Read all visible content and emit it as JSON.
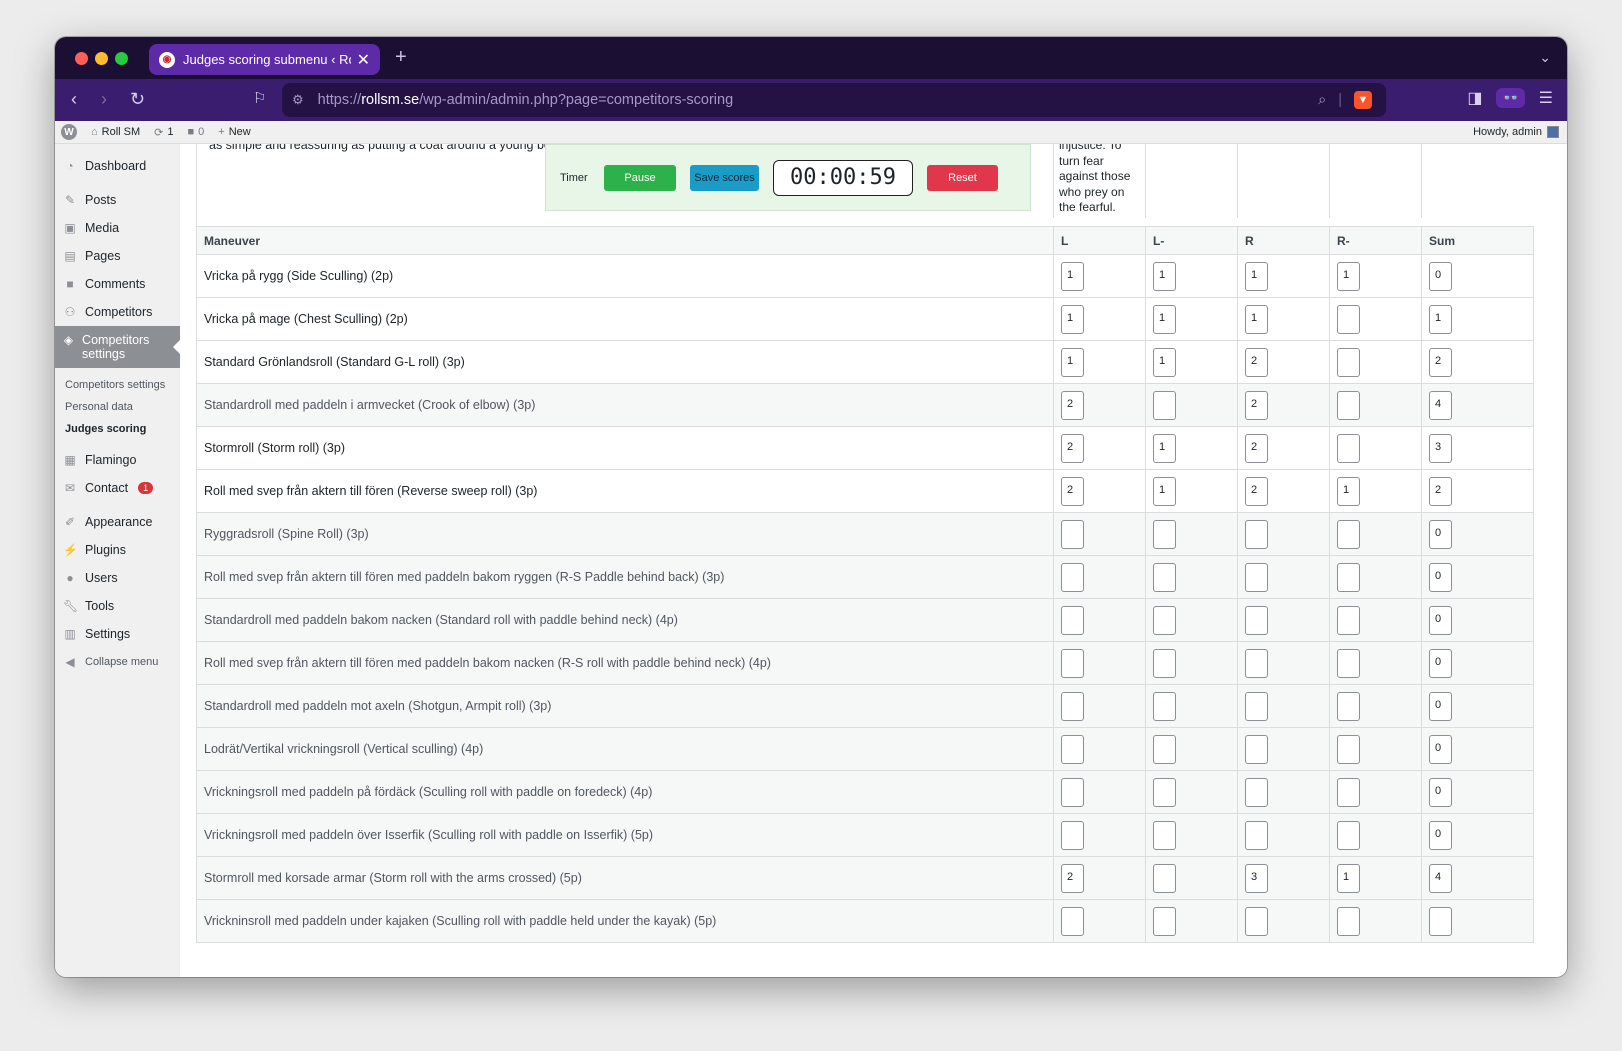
{
  "browser": {
    "tab_title": "Judges scoring submenu ‹ Ro",
    "url_prefix": "https://",
    "url_host": "rollsm.se",
    "url_path": "/wp-admin/admin.php?page=competitors-scoring"
  },
  "adminbar": {
    "site_name": "Roll SM",
    "updates_count": "1",
    "comments_count": "0",
    "new_label": "New",
    "howdy": "Howdy, admin"
  },
  "sidebar": {
    "dashboard": "Dashboard",
    "posts": "Posts",
    "media": "Media",
    "pages": "Pages",
    "comments": "Comments",
    "competitors": "Competitors",
    "competitors_settings": "Competitors settings",
    "sub_competitors_settings": "Competitors settings",
    "sub_personal_data": "Personal data",
    "sub_judges_scoring": "Judges scoring",
    "flamingo": "Flamingo",
    "contact": "Contact",
    "contact_badge": "1",
    "appearance": "Appearance",
    "plugins": "Plugins",
    "users": "Users",
    "tools": "Tools",
    "settings": "Settings",
    "collapse": "Collapse menu"
  },
  "top": {
    "story_text": "as simple and reassuring as putting a coat around a young boy",
    "quote_lines": [
      "injustice. To",
      "turn fear",
      "against those",
      "who prey on",
      "the fearful."
    ]
  },
  "timer": {
    "label": "Timer",
    "pause_label": "Pause",
    "save_label": "Save scores",
    "display": "00:00:59",
    "reset_label": "Reset"
  },
  "table": {
    "headers": [
      "Maneuver",
      "L",
      "L-",
      "R",
      "R-",
      "Sum"
    ],
    "rows": [
      {
        "name": "Vricka på rygg (Side Sculling) (2p)",
        "L": "1",
        "Lm": "1",
        "R": "1",
        "Rm": "1",
        "Sum": "0"
      },
      {
        "name": "Vricka på mage (Chest Sculling) (2p)",
        "L": "1",
        "Lm": "1",
        "R": "1",
        "Rm": "",
        "Sum": "1"
      },
      {
        "name": "Standard Grönlandsroll (Standard G-L roll) (3p)",
        "L": "1",
        "Lm": "1",
        "R": "2",
        "Rm": "",
        "Sum": "2"
      },
      {
        "name": "Standardroll med paddeln i armvecket (Crook of elbow) (3p)",
        "L": "2",
        "Lm": "",
        "R": "2",
        "Rm": "",
        "Sum": "4"
      },
      {
        "name": "Stormroll (Storm roll) (3p)",
        "L": "2",
        "Lm": "1",
        "R": "2",
        "Rm": "",
        "Sum": "3"
      },
      {
        "name": "Roll med svep från aktern till fören (Reverse sweep roll) (3p)",
        "L": "2",
        "Lm": "1",
        "R": "2",
        "Rm": "1",
        "Sum": "2"
      },
      {
        "name": "Ryggradsroll (Spine Roll) (3p)",
        "L": "",
        "Lm": "",
        "R": "",
        "Rm": "",
        "Sum": "0"
      },
      {
        "name": "Roll med svep från aktern till fören med paddeln bakom ryggen (R-S Paddle behind back) (3p)",
        "L": "",
        "Lm": "",
        "R": "",
        "Rm": "",
        "Sum": "0"
      },
      {
        "name": "Standardroll med paddeln bakom nacken (Standard roll with paddle behind neck) (4p)",
        "L": "",
        "Lm": "",
        "R": "",
        "Rm": "",
        "Sum": "0"
      },
      {
        "name": "Roll med svep från aktern till fören med paddeln bakom nacken (R-S roll with paddle behind neck) (4p)",
        "L": "",
        "Lm": "",
        "R": "",
        "Rm": "",
        "Sum": "0"
      },
      {
        "name": "Standardroll med paddeln mot axeln (Shotgun, Armpit roll) (3p)",
        "L": "",
        "Lm": "",
        "R": "",
        "Rm": "",
        "Sum": "0"
      },
      {
        "name": "Lodrät/Vertikal vrickningsroll (Vertical sculling) (4p)",
        "L": "",
        "Lm": "",
        "R": "",
        "Rm": "",
        "Sum": "0"
      },
      {
        "name": "Vrickningsroll med paddeln på fördäck (Sculling roll with paddle on foredeck) (4p)",
        "L": "",
        "Lm": "",
        "R": "",
        "Rm": "",
        "Sum": "0"
      },
      {
        "name": "Vrickningsroll med paddeln över Isserfik (Sculling roll with paddle on Isserfik) (5p)",
        "L": "",
        "Lm": "",
        "R": "",
        "Rm": "",
        "Sum": "0"
      },
      {
        "name": "Stormroll med korsade armar (Storm roll with the arms crossed) (5p)",
        "L": "2",
        "Lm": "",
        "R": "3",
        "Rm": "1",
        "Sum": "4"
      },
      {
        "name": "Vrickninsroll med paddeln under kajaken (Sculling roll with paddle held under the kayak) (5p)",
        "L": "",
        "Lm": "",
        "R": "",
        "Rm": "",
        "Sum": ""
      }
    ]
  },
  "colors": {
    "browser_tabbar": "#1b0f33",
    "browser_toolbar": "#3a1d6e",
    "active_tab": "#5d2aa8",
    "pause": "#2db14b",
    "save": "#1a9bc8",
    "reset": "#e0384a",
    "timer_panel": "#e8f6e8"
  }
}
